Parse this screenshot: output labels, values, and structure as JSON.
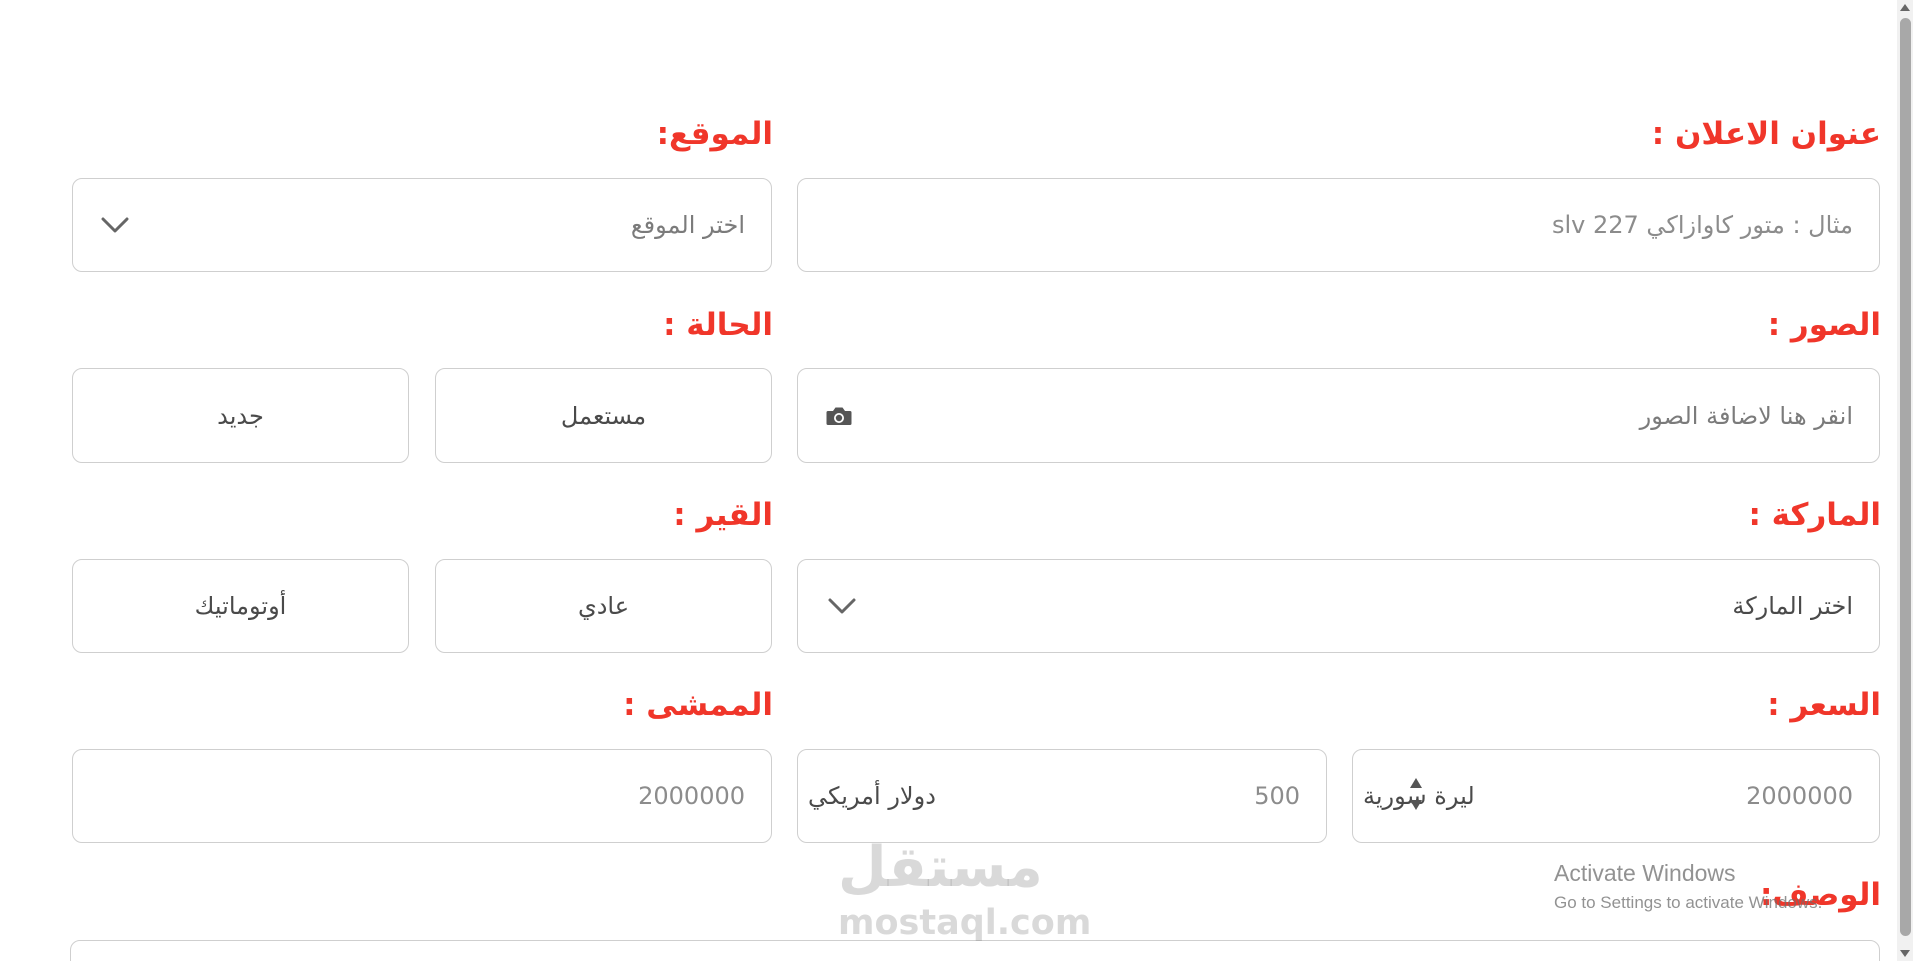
{
  "form": {
    "ad_title": {
      "label": "عنوان الاعلان :",
      "placeholder": "مثال : متور كاوازاكي slv 227"
    },
    "location": {
      "label": "الموقع:",
      "placeholder": "اختر الموقع"
    },
    "images": {
      "label": "الصور :",
      "placeholder": "انقر هنا لاضافة الصور"
    },
    "condition": {
      "label": "الحالة :",
      "options": [
        "مستعمل",
        "جديد"
      ]
    },
    "brand": {
      "label": "الماركة :",
      "placeholder": "اختر الماركة"
    },
    "transmission": {
      "label": "القير :",
      "options": [
        "عادي",
        "أوتوماتيك"
      ]
    },
    "price": {
      "label": "السعر :",
      "syp_value": "2000000",
      "syp_currency": "ليرة سورية",
      "usd_value": "500",
      "usd_currency": "دولار أمريكي"
    },
    "mileage": {
      "label": "الممشى :",
      "value": "2000000"
    },
    "description": {
      "label": "الوصف:"
    }
  },
  "overlay": {
    "watermark_arabic": "مستقل",
    "watermark_url": "mostaql.com",
    "activate_title": "Activate Windows",
    "activate_subtitle": "Go to Settings to activate Windows."
  },
  "colors": {
    "label_red": "#f0362a",
    "border_gray": "#cfcfcf"
  }
}
